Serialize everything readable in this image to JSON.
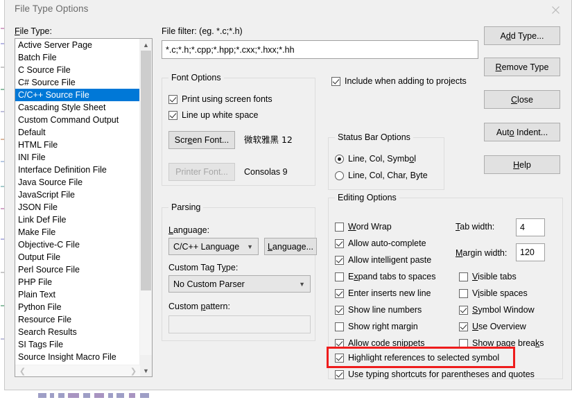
{
  "window": {
    "title": "File Type Options",
    "close_icon": "close-icon"
  },
  "file_type": {
    "label": "File Type:",
    "items": [
      "Active Server Page",
      "Batch File",
      "C Source File",
      "C# Source File",
      "C/C++ Source File",
      "Cascading Style Sheet",
      "Custom Command Output",
      "Default",
      "HTML File",
      "INI File",
      "Interface Definition File",
      "Java Source File",
      "JavaScript File",
      "JSON File",
      "Link Def File",
      "Make File",
      "Objective-C File",
      "Output File",
      "Perl Source File",
      "PHP File",
      "Plain Text",
      "Python File",
      "Resource File",
      "Search Results",
      "SI Tags File",
      "Source Insight Macro File"
    ],
    "selected_index": 4,
    "selected": "C/C++ Source File",
    "scroll_up_icon": "chevron-up-icon",
    "scroll_down_icon": "chevron-down-icon",
    "scroll_left_icon": "chevron-left-icon",
    "scroll_right_icon": "chevron-right-icon"
  },
  "file_filter": {
    "label": "File filter: (eg. *.c;*.h)",
    "value": "*.c;*.h;*.cpp;*.hpp;*.cxx;*.hxx;*.hh"
  },
  "include_projects": {
    "label": "Include when adding to projects",
    "checked": true
  },
  "font_options": {
    "title": "Font Options",
    "print_using_screen_fonts": {
      "label": "Print using screen fonts",
      "checked": true
    },
    "line_up_white_space": {
      "label": "Line up white space",
      "checked": true
    },
    "screen_font_button": "Screen Font...",
    "screen_font_value": "微软雅黑 12",
    "printer_font_button": "Printer Font...",
    "printer_font_value": "Consolas 9",
    "printer_font_disabled": true
  },
  "status_bar_options": {
    "title": "Status Bar Options",
    "options": [
      {
        "label": "Line, Col, Symbol",
        "selected": true
      },
      {
        "label": "Line, Col, Char, Byte",
        "selected": false
      }
    ]
  },
  "parsing": {
    "title": "Parsing",
    "language_label": "Language:",
    "language_value": "C/C++ Language",
    "language_button": "Language...",
    "custom_tag_label": "Custom Tag Type:",
    "custom_tag_value": "No Custom Parser",
    "custom_pattern_label": "Custom pattern:",
    "custom_pattern_value": "",
    "dropdown_icon": "chevron-down-icon"
  },
  "editing_options": {
    "title": "Editing Options",
    "left_column": [
      {
        "label": "Word Wrap",
        "checked": false,
        "accel": "W"
      },
      {
        "label": "Allow auto-complete",
        "checked": true
      },
      {
        "label": "Allow intelligent paste",
        "checked": true
      },
      {
        "label": "Expand tabs to spaces",
        "checked": false,
        "accel": "x"
      },
      {
        "label": "Enter inserts new line",
        "checked": true
      },
      {
        "label": "Show line numbers",
        "checked": true
      },
      {
        "label": "Show right margin",
        "checked": false
      },
      {
        "label": "Allow code snippets",
        "checked": true
      }
    ],
    "right_column": [
      {
        "label": "Visible tabs",
        "checked": false,
        "accel": "V"
      },
      {
        "label": "Visible spaces",
        "checked": false,
        "accel": "i"
      },
      {
        "label": "Symbol Window",
        "checked": true,
        "accel": "S"
      },
      {
        "label": "Use Overview",
        "checked": true,
        "accel": "U"
      },
      {
        "label": "Show page breaks",
        "checked": false,
        "accel": "k"
      }
    ],
    "full_width": [
      {
        "label": "Highlight references to selected symbol",
        "checked": true,
        "highlighted": true
      },
      {
        "label": "Use typing shortcuts for parentheses and quotes",
        "checked": true,
        "highlighted": false
      }
    ],
    "tab_width_label": "Tab width:",
    "tab_width_value": "4",
    "margin_width_label": "Margin width:",
    "margin_width_value": "120"
  },
  "buttons": [
    {
      "label": "Add Type...",
      "accel": "d"
    },
    {
      "label": "Remove Type",
      "accel": "R"
    },
    {
      "label": "Close",
      "accel": "C"
    },
    {
      "label": "Auto Indent...",
      "accel": "o"
    },
    {
      "label": "Help",
      "accel": "H"
    }
  ],
  "colors": {
    "selection_blue": "#0078d7",
    "highlight_red": "#ee1c1c",
    "dialog_bg": "#f0f0f0",
    "title_text": "#6a6a6a"
  }
}
